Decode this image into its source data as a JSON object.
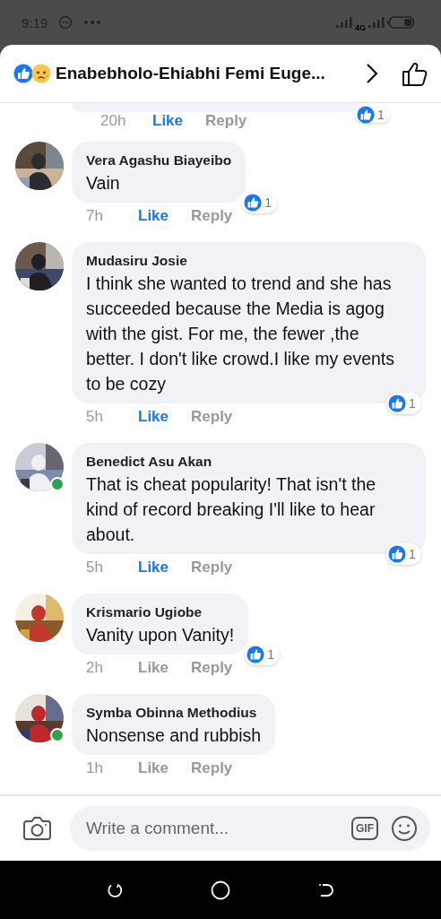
{
  "status_bar": {
    "time": "9:19",
    "network": "4G"
  },
  "header": {
    "title": "Enabebholo-Ehiabhi Femi Euge..."
  },
  "top_comment_tail": {
    "time": "20h",
    "like": "Like",
    "reply": "Reply",
    "liked": true,
    "reactions": "1"
  },
  "comments": [
    {
      "name": "Vera Agashu Biayeibo",
      "text": "Vain",
      "time": "7h",
      "like": "Like",
      "reply": "Reply",
      "liked": true,
      "reactions": "1",
      "online": false
    },
    {
      "name": "Mudasiru Josie",
      "text": "I think she wanted to trend and she has succeeded because the Media is agog with the gist. For me, the fewer ,the better. I don't like crowd.I like my events to be cozy",
      "time": "5h",
      "like": "Like",
      "reply": "Reply",
      "liked": true,
      "reactions": "1",
      "online": false
    },
    {
      "name": "Benedict Asu Akan",
      "text": "That is cheat popularity! That isn't the kind of record breaking I'll like to hear about.",
      "time": "5h",
      "like": "Like",
      "reply": "Reply",
      "liked": true,
      "reactions": "1",
      "online": true
    },
    {
      "name": "Krismario Ugiobe",
      "text": "Vanity upon Vanity!",
      "time": "2h",
      "like": "Like",
      "reply": "Reply",
      "liked": false,
      "reactions": "1",
      "online": false
    },
    {
      "name": "Symba Obinna Methodius",
      "text": "Nonsense and rubbish",
      "time": "1h",
      "like": "Like",
      "reply": "Reply",
      "liked": false,
      "online": true
    }
  ],
  "composer": {
    "placeholder": "Write a comment...",
    "gif": "GIF"
  }
}
